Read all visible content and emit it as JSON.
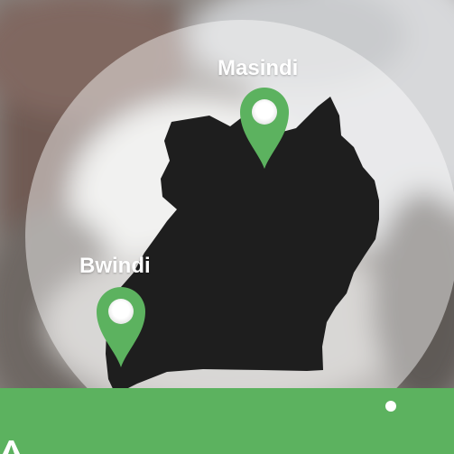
{
  "map": {
    "country_shape": "uganda-silhouette",
    "locations": [
      {
        "name": "Masindi",
        "marker": "map-pin-icon"
      },
      {
        "name": "Bwindi",
        "marker": "map-pin-icon"
      }
    ]
  },
  "colors": {
    "country_fill": "#1e1e1e",
    "pin_green": "#5cb25f",
    "bottom_bar": "#5cb25f",
    "label_text": "#ffffff"
  }
}
